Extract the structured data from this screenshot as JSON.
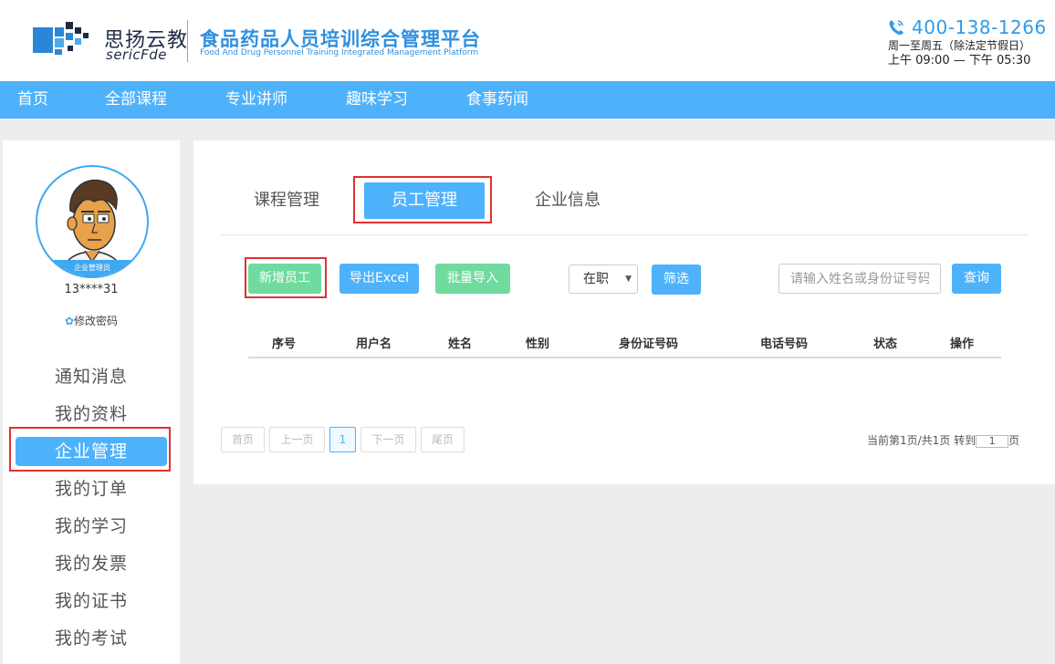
{
  "header": {
    "brand_name": "思扬云教",
    "brand_en": "sericFde",
    "platform_title": "食品药品人员培训综合管理平台",
    "platform_subtitle": "Food And Drug Personnel Training Integrated Management Platform",
    "phone": "400-138-1266",
    "hours_days": "周一至周五（除法定节假日）",
    "hours_time": "上午 09:00 — 下午 05:30"
  },
  "nav": [
    "首页",
    "全部课程",
    "专业讲师",
    "趣味学习",
    "食事药闻"
  ],
  "sidebar": {
    "avatar_badge": "企业管理员",
    "account": "13****31",
    "change_password": "修改密码",
    "menu": [
      "通知消息",
      "我的资料",
      "企业管理",
      "我的订单",
      "我的学习",
      "我的发票",
      "我的证书",
      "我的考试"
    ],
    "active_menu": "企业管理"
  },
  "tabs": [
    "课程管理",
    "员工管理",
    "企业信息"
  ],
  "active_tab": "员工管理",
  "toolbar": {
    "add_employee": "新增员工",
    "export_excel": "导出Excel",
    "batch_import": "批量导入",
    "status_value": "在职",
    "filter": "筛选",
    "search_placeholder": "请输入姓名或身份证号码",
    "query": "查询"
  },
  "table": {
    "columns": [
      "序号",
      "用户名",
      "姓名",
      "性别",
      "身份证号码",
      "电话号码",
      "状态",
      "操作"
    ],
    "rows": []
  },
  "pagination": {
    "first": "首页",
    "prev": "上一页",
    "current": "1",
    "next": "下一页",
    "last": "尾页",
    "info": "当前第1页/共1页 转到",
    "jump_value": "1",
    "suffix": "页"
  },
  "colors": {
    "accent": "#4eb2fb",
    "green": "#6fdb9e",
    "highlight": "#e2312f"
  }
}
